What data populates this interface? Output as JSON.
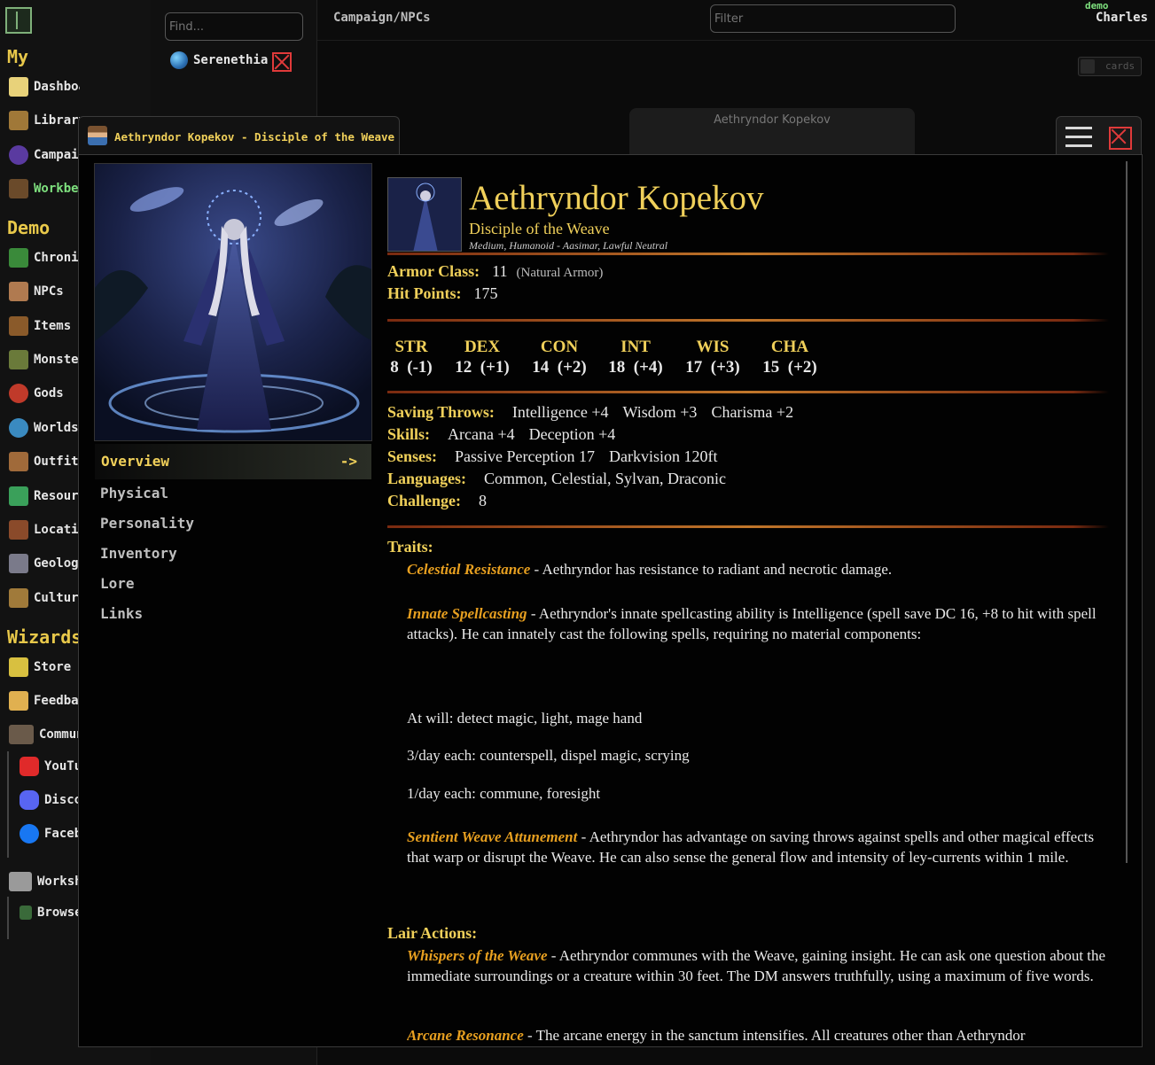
{
  "nav": {
    "sections": {
      "my": "My",
      "demo": "Demo",
      "wizards": "Wizards"
    },
    "my_items": [
      "Dashboard",
      "Library",
      "Campaigns",
      "Workbench"
    ],
    "demo_items": [
      "Chronicles",
      "NPCs",
      "Items",
      "Monsters",
      "Gods",
      "Worlds",
      "Outfits",
      "Resources",
      "Locations",
      "Geology",
      "Cultures"
    ],
    "wizard_items": [
      "Store",
      "Feedback",
      "Community"
    ],
    "community_items": [
      "YouTube",
      "Discord",
      "Facebook"
    ],
    "workshop": "Workshop",
    "workshop_items": [
      "Browse"
    ]
  },
  "search": {
    "placeholder": "Find...",
    "world": "Serenethia"
  },
  "topbar": {
    "breadcrumb": "Campaign/NPCs",
    "filter_placeholder": "Filter",
    "user_role": "demo",
    "user_name": "Charles w"
  },
  "background": {
    "cards_label": "cards",
    "card_title": "Aethryndor Kopekov"
  },
  "modal": {
    "tab_title": "Aethryndor Kopekov - Disciple of the Weave",
    "sections": {
      "active": "Overview",
      "arrow": "->",
      "items": [
        "Physical",
        "Personality",
        "Inventory",
        "Lore",
        "Links"
      ]
    }
  },
  "statblock": {
    "name": "Aethryndor Kopekov",
    "subtitle": "Disciple of the Weave",
    "type_line": "Medium, Humanoid - Aasimar, Lawful Neutral",
    "armor_class": {
      "label": "Armor Class:",
      "value": "11",
      "note": "(Natural Armor)"
    },
    "hit_points": {
      "label": "Hit Points:",
      "value": "175"
    },
    "abilities": [
      {
        "name": "STR",
        "score": "8",
        "mod": "(-1)"
      },
      {
        "name": "DEX",
        "score": "12",
        "mod": "(+1)"
      },
      {
        "name": "CON",
        "score": "14",
        "mod": "(+2)"
      },
      {
        "name": "INT",
        "score": "18",
        "mod": "(+4)"
      },
      {
        "name": "WIS",
        "score": "17",
        "mod": "(+3)"
      },
      {
        "name": "CHA",
        "score": "15",
        "mod": "(+2)"
      }
    ],
    "saving_throws": {
      "label": "Saving Throws:",
      "items": [
        "Intelligence +4",
        "Wisdom +3",
        "Charisma +2"
      ]
    },
    "skills": {
      "label": "Skills:",
      "items": [
        "Arcana +4",
        "Deception +4"
      ]
    },
    "senses": {
      "label": "Senses:",
      "items": [
        "Passive Perception 17",
        "Darkvision 120ft"
      ]
    },
    "languages": {
      "label": "Languages:",
      "items": [
        "Common,",
        "Celestial,",
        "Sylvan,",
        "Draconic"
      ]
    },
    "challenge": {
      "label": "Challenge:",
      "value": "8"
    },
    "traits_label": "Traits:",
    "traits": [
      {
        "name": "Celestial Resistance",
        "text": " - Aethryndor has resistance to radiant and necrotic damage."
      },
      {
        "name": "Innate Spellcasting",
        "text": " - Aethryndor's innate spellcasting ability is Intelligence (spell save DC 16, +8 to hit with spell attacks). He can innately cast the following spells, requiring no material components:"
      },
      {
        "name": "Sentient Weave Attunement",
        "text": " - Aethryndor has advantage on saving throws against spells and other magical effects that warp or disrupt the Weave. He can also sense the general flow and intensity of ley-currents within 1 mile."
      }
    ],
    "spells": [
      "At will: detect magic, light, mage hand",
      "3/day each: counterspell, dispel magic, scrying",
      "1/day each: commune, foresight"
    ],
    "lair_label": "Lair Actions:",
    "lair_actions": [
      {
        "name": "Whispers of the Weave",
        "text": " - Aethryndor communes with the Weave, gaining insight. He can ask one question about the immediate surroundings or a creature within 30 feet. The DM answers truthfully, using a maximum of five words."
      },
      {
        "name": "Arcane Resonance",
        "text": " - The arcane energy in the sanctum intensifies. All creatures other than Aethryndor"
      }
    ]
  }
}
